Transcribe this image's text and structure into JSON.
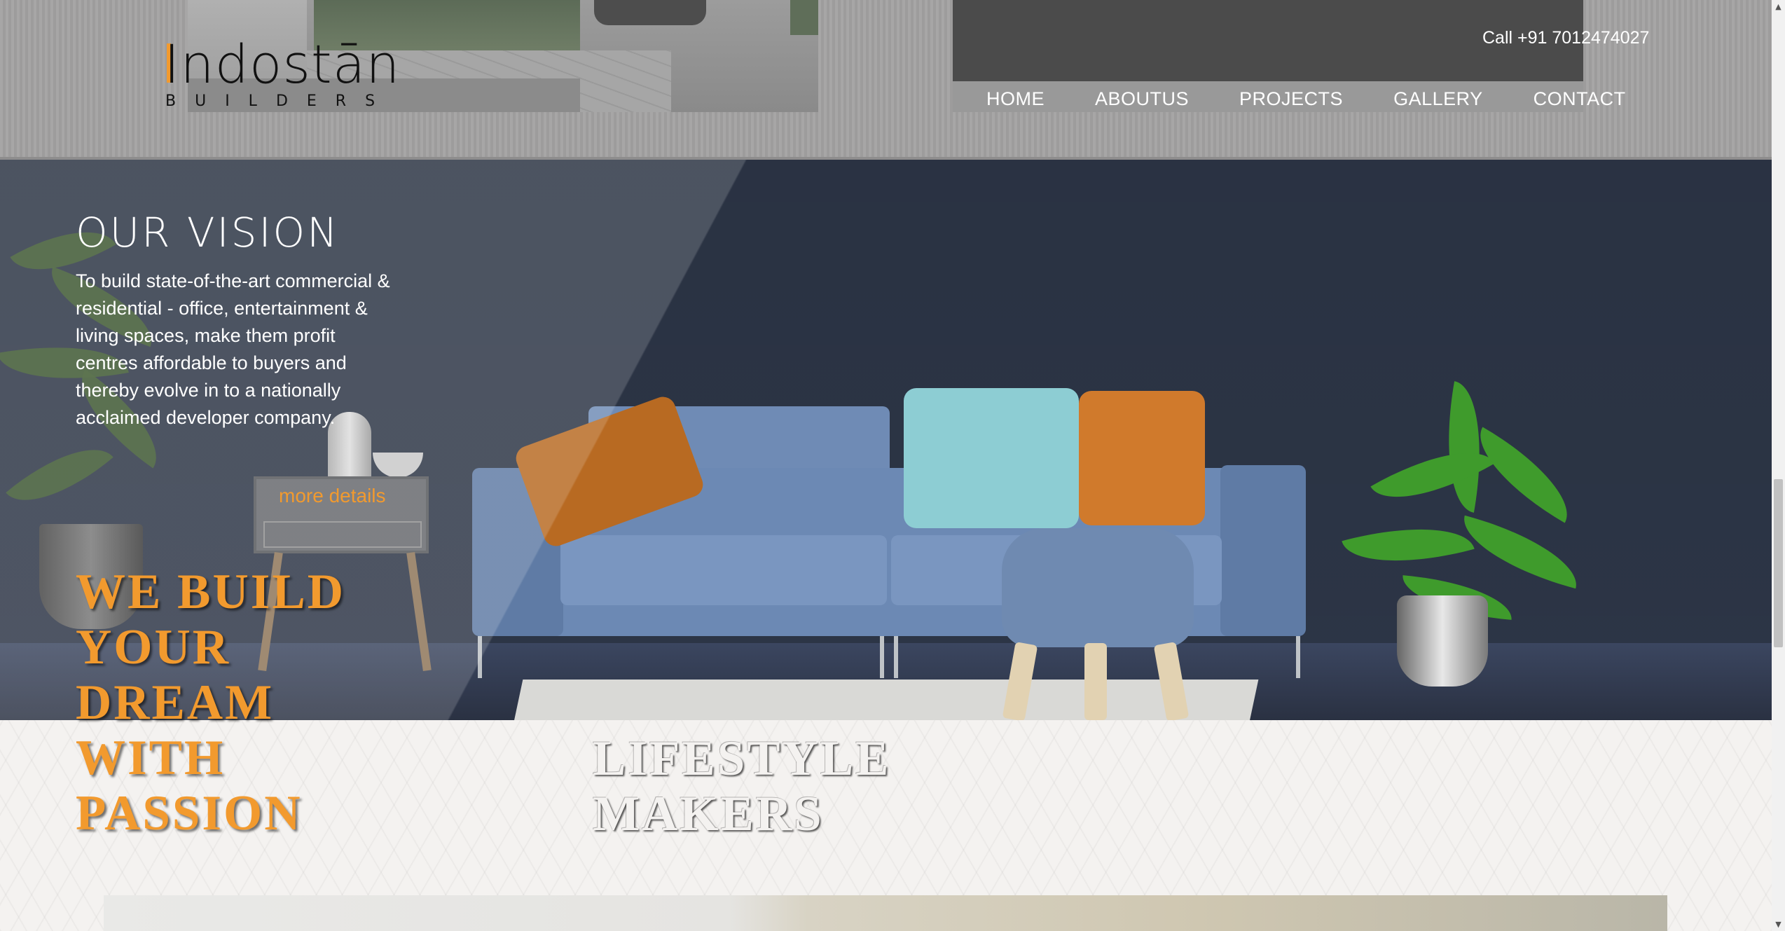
{
  "header": {
    "logo_text": "Indostān",
    "logo_subtext": "BUILDERS",
    "phone": "Call +91 7012474027",
    "nav": [
      {
        "label": "HOME"
      },
      {
        "label": "ABOUTUS"
      },
      {
        "label": "PROJECTS"
      },
      {
        "label": "GALLERY"
      },
      {
        "label": "CONTACT"
      }
    ]
  },
  "hero": {
    "vision_title": "OUR VISION",
    "vision_text": "To build state-of-the-art commercial & residential - office, entertainment & living spaces, make them profit centres affordable to buyers and thereby evolve in to a nationally acclaimed developer company.",
    "more_details": "more details"
  },
  "slogan": {
    "lines": [
      "WE  BUILD",
      "YOUR",
      "DREAM",
      "WITH",
      "PASSION"
    ]
  },
  "lifestyle": {
    "lines": [
      "LIFESTYLE",
      "MAKERS"
    ]
  },
  "colors": {
    "accent": "#f29a2e",
    "header_bg": "#a2a1a1",
    "nav_bg": "#4b4b4b",
    "hero_wall": "#2c3546"
  },
  "scrollbar": {
    "up_icon": "arrow-up-icon",
    "down_icon": "arrow-down-icon"
  }
}
